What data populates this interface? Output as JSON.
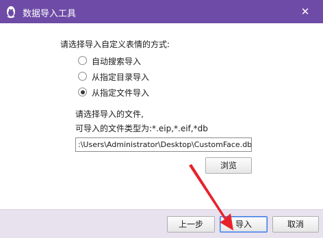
{
  "window": {
    "title": "数据导入工具",
    "close_glyph": "✕"
  },
  "prompt": "请选择导入自定义表情的方式:",
  "options": [
    {
      "label": "自动搜索导入",
      "checked": false
    },
    {
      "label": "从指定目录导入",
      "checked": false
    },
    {
      "label": "从指定文件导入",
      "checked": true
    }
  ],
  "file_section": {
    "hint_line1": "请选择导入的文件,",
    "hint_line2": "可导入的文件类型为:*.eip,*.eif,*db",
    "path_value": ":\\Users\\Administrator\\Desktop\\CustomFace.db",
    "browse_label": "浏览"
  },
  "footer": {
    "prev_label": "上一步",
    "import_label": "导入",
    "cancel_label": "取消"
  },
  "colors": {
    "titlebar": "#6e4ba6",
    "footer": "#e8e2ef",
    "annotation_arrow": "#e8222a"
  }
}
